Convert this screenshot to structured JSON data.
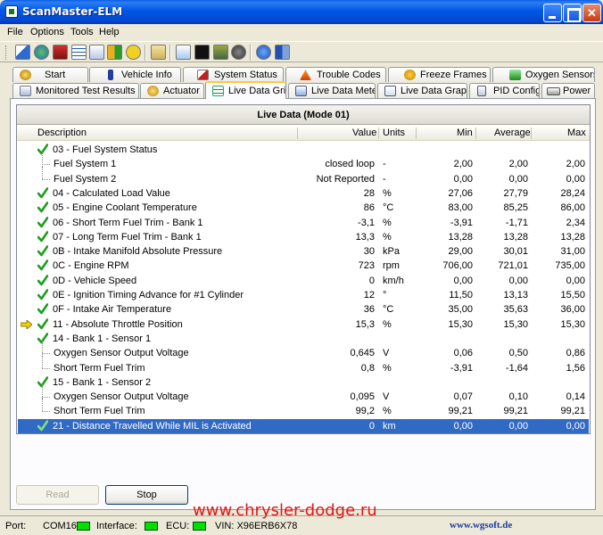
{
  "window": {
    "title": "ScanMaster-ELM"
  },
  "menu": [
    "File",
    "Options",
    "Tools",
    "Help"
  ],
  "tabs_row1": [
    {
      "label": "Start",
      "icon": "start-icon"
    },
    {
      "label": "Vehicle Info",
      "icon": "info-icon"
    },
    {
      "label": "System Status",
      "icon": "system-status-icon"
    },
    {
      "label": "Trouble Codes",
      "icon": "warning-icon"
    },
    {
      "label": "Freeze Frames",
      "icon": "freeze-frames-icon"
    },
    {
      "label": "Oxygen Sensors",
      "icon": "oxygen-sensors-icon"
    }
  ],
  "tabs_row2": [
    {
      "label": "Monitored Test Results",
      "icon": "monitored-tests-icon"
    },
    {
      "label": "Actuator",
      "icon": "actuator-icon"
    },
    {
      "label": "Live Data Grid",
      "icon": "grid-icon",
      "active": true
    },
    {
      "label": "Live Data Meter",
      "icon": "meter-icon"
    },
    {
      "label": "Live Data Graph",
      "icon": "graph-icon"
    },
    {
      "label": "PID Config",
      "icon": "pid-config-icon"
    },
    {
      "label": "Power",
      "icon": "power-icon"
    }
  ],
  "grid": {
    "title": "Live Data (Mode 01)",
    "columns": {
      "description": "Description",
      "value": "Value",
      "units": "Units",
      "min": "Min",
      "average": "Average",
      "max": "Max"
    },
    "rows": [
      {
        "desc": "03 - Fuel System Status",
        "value": "",
        "units": "",
        "min": "",
        "avg": "",
        "max": "",
        "check": true,
        "level": 0
      },
      {
        "desc": "Fuel System 1",
        "value": "closed loop",
        "units": "-",
        "min": "2,00",
        "avg": "2,00",
        "max": "2,00",
        "check": false,
        "level": 1
      },
      {
        "desc": "Fuel System 2",
        "value": "Not Reported",
        "units": "-",
        "min": "0,00",
        "avg": "0,00",
        "max": "0,00",
        "check": false,
        "level": 1,
        "last": true
      },
      {
        "desc": "04 - Calculated Load Value",
        "value": "28",
        "units": "%",
        "min": "27,06",
        "avg": "27,79",
        "max": "28,24",
        "check": true,
        "level": 0
      },
      {
        "desc": "05 - Engine Coolant Temperature",
        "value": "86",
        "units": "°C",
        "min": "83,00",
        "avg": "85,25",
        "max": "86,00",
        "check": true,
        "level": 0
      },
      {
        "desc": "06 - Short Term Fuel Trim - Bank 1",
        "value": "-3,1",
        "units": "%",
        "min": "-3,91",
        "avg": "-1,71",
        "max": "2,34",
        "check": true,
        "level": 0
      },
      {
        "desc": "07 - Long Term Fuel Trim - Bank 1",
        "value": "13,3",
        "units": "%",
        "min": "13,28",
        "avg": "13,28",
        "max": "13,28",
        "check": true,
        "level": 0
      },
      {
        "desc": "0B - Intake Manifold Absolute Pressure",
        "value": "30",
        "units": "kPa",
        "min": "29,00",
        "avg": "30,01",
        "max": "31,00",
        "check": true,
        "level": 0
      },
      {
        "desc": "0C - Engine RPM",
        "value": "723",
        "units": "rpm",
        "min": "706,00",
        "avg": "721,01",
        "max": "735,00",
        "check": true,
        "level": 0
      },
      {
        "desc": "0D - Vehicle Speed",
        "value": "0",
        "units": "km/h",
        "min": "0,00",
        "avg": "0,00",
        "max": "0,00",
        "check": true,
        "level": 0
      },
      {
        "desc": "0E - Ignition Timing Advance for #1 Cylinder",
        "value": "12",
        "units": "°",
        "min": "11,50",
        "avg": "13,13",
        "max": "15,50",
        "check": true,
        "level": 0
      },
      {
        "desc": "0F - Intake Air Temperature",
        "value": "36",
        "units": "°C",
        "min": "35,00",
        "avg": "35,63",
        "max": "36,00",
        "check": true,
        "level": 0
      },
      {
        "desc": "11 - Absolute Throttle Position",
        "value": "15,3",
        "units": "%",
        "min": "15,30",
        "avg": "15,30",
        "max": "15,30",
        "check": true,
        "level": 0,
        "arrow": true
      },
      {
        "desc": "14 - Bank 1 - Sensor 1",
        "value": "",
        "units": "",
        "min": "",
        "avg": "",
        "max": "",
        "check": true,
        "level": 0
      },
      {
        "desc": "Oxygen Sensor Output Voltage",
        "value": "0,645",
        "units": "V",
        "min": "0,06",
        "avg": "0,50",
        "max": "0,86",
        "check": false,
        "level": 1
      },
      {
        "desc": "Short Term Fuel Trim",
        "value": "0,8",
        "units": "%",
        "min": "-3,91",
        "avg": "-1,64",
        "max": "1,56",
        "check": false,
        "level": 1,
        "last": true
      },
      {
        "desc": "15 - Bank 1 - Sensor 2",
        "value": "",
        "units": "",
        "min": "",
        "avg": "",
        "max": "",
        "check": true,
        "level": 0
      },
      {
        "desc": "Oxygen Sensor Output Voltage",
        "value": "0,095",
        "units": "V",
        "min": "0,07",
        "avg": "0,10",
        "max": "0,14",
        "check": false,
        "level": 1
      },
      {
        "desc": "Short Term Fuel Trim",
        "value": "99,2",
        "units": "%",
        "min": "99,21",
        "avg": "99,21",
        "max": "99,21",
        "check": false,
        "level": 1,
        "last": true
      },
      {
        "desc": "21 - Distance Travelled While MIL is Activated",
        "value": "0",
        "units": "km",
        "min": "0,00",
        "avg": "0,00",
        "max": "0,00",
        "check": true,
        "level": 0,
        "selected": true
      }
    ]
  },
  "buttons": {
    "read": "Read",
    "stop": "Stop"
  },
  "status": {
    "port_label": "Port:",
    "port_value": "COM16",
    "interface_label": "Interface:",
    "ecu_label": "ECU:",
    "vin": "VIN: X96ERB6X78",
    "watermark": "www.chrysler-dodge.ru",
    "site": "www.wgsoft.de"
  },
  "colors": {
    "selected_row": "#316ac5",
    "check": "#1e9e1e",
    "arrow": "#f0d000",
    "led": "#00e000"
  }
}
